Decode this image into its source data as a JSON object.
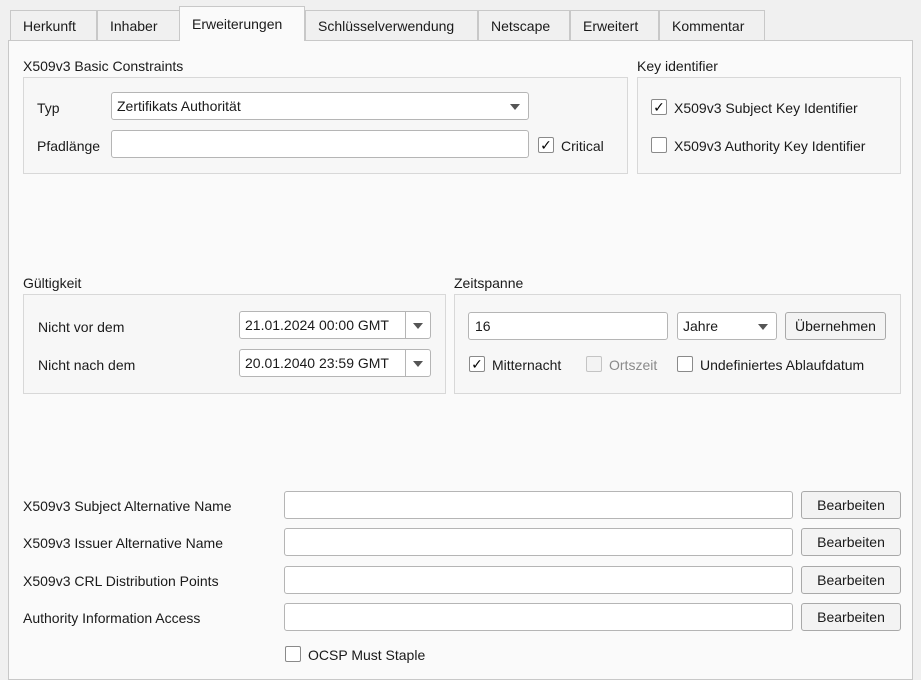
{
  "tabs": [
    "Herkunft",
    "Inhaber",
    "Erweiterungen",
    "Schlüsselverwendung",
    "Netscape",
    "Erweitert",
    "Kommentar"
  ],
  "basic_constraints": {
    "title": "X509v3 Basic Constraints",
    "type_label": "Typ",
    "type_value": "Zertifikats Authorität",
    "pathlen_label": "Pfadlänge",
    "pathlen_value": "",
    "critical_label": "Critical",
    "critical_checked": true
  },
  "key_identifier": {
    "title": "Key identifier",
    "subject_label": "X509v3 Subject Key Identifier",
    "subject_checked": true,
    "authority_label": "X509v3 Authority Key Identifier",
    "authority_checked": false
  },
  "validity": {
    "title": "Gültigkeit",
    "not_before_label": "Nicht vor dem",
    "not_before_value": "21.01.2024 00:00 GMT",
    "not_after_label": "Nicht nach dem",
    "not_after_value": "20.01.2040 23:59 GMT"
  },
  "timespan": {
    "title": "Zeitspanne",
    "amount": "16",
    "unit": "Jahre",
    "apply_label": "Übernehmen",
    "midnight_label": "Mitternacht",
    "midnight_checked": true,
    "localtime_label": "Ortszeit",
    "localtime_checked": false,
    "undefined_label": "Undefiniertes Ablaufdatum",
    "undefined_checked": false
  },
  "extensions": {
    "edit_label": "Bearbeiten",
    "rows": [
      {
        "label": "X509v3 Subject Alternative Name",
        "value": ""
      },
      {
        "label": "X509v3 Issuer Alternative Name",
        "value": ""
      },
      {
        "label": "X509v3 CRL Distribution Points",
        "value": ""
      },
      {
        "label": "Authority Information Access",
        "value": ""
      }
    ],
    "ocsp_label": "OCSP Must Staple",
    "ocsp_checked": false
  },
  "check_glyph": "✓",
  "highlight_color": "#ffef1a"
}
